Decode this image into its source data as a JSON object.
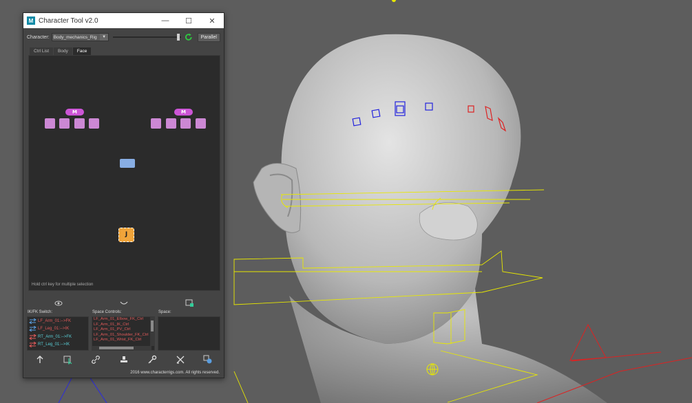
{
  "window": {
    "title": "Character Tool v2.0",
    "app_icon": "M",
    "minimize_glyph": "—",
    "maximize_glyph": "☐",
    "close_glyph": "✕"
  },
  "toolbar": {
    "character_label": "Character:",
    "character_value": "Body_mechanics_Rig",
    "slider_value": 1.0,
    "refresh_icon": "refresh-icon",
    "parallel_label": "Parallel"
  },
  "tabs": [
    {
      "label": "Ctrl List",
      "active": false
    },
    {
      "label": "Body",
      "active": false
    },
    {
      "label": "Face",
      "active": true
    }
  ],
  "picker": {
    "left_group_label": "M",
    "right_group_label": "M",
    "jaw_label": "J",
    "hint": "Hold ctrl key for multiple selection",
    "colors": {
      "eyebrow": "#cc88d4",
      "master": "#cc55d6",
      "nose": "#88aee4",
      "jaw": "#f0a43a"
    }
  },
  "panels": {
    "ikfk_label": "IK/FK Switch:",
    "space_controls_label": "Space Controls:",
    "space_label": "Space:"
  },
  "ikfk_items": [
    {
      "text": "LF_Arm_01:-->FK",
      "color": "#e05a5a"
    },
    {
      "text": "LF_Leg_01:-->IK",
      "color": "#e05a5a"
    },
    {
      "text": "RT_Arm_01:-->FK",
      "color": "#5ad0d8"
    },
    {
      "text": "RT_Leg_01:-->IK",
      "color": "#5ad0d8"
    }
  ],
  "space_control_items": [
    "LF_Arm_01_Elbow_FK_Ctrl",
    "LF_Arm_01_IK_Ctrl",
    "LF_Arm_01_PV_Ctrl",
    "LF_Arm_01_Shoulder_FK_Ctrl",
    "LF_Arm_01_Wrist_FK_Ctrl"
  ],
  "icons": {
    "mid": [
      "eye-icon",
      "smile-icon",
      "image-layer-icon"
    ],
    "bottom": [
      "arrow-up-icon",
      "select-icon",
      "link-icon",
      "stamp-icon",
      "key-icon",
      "reset-icon",
      "mirror-icon"
    ]
  },
  "copyright": "2016 www.characterrigs.com. All rights reserved."
}
